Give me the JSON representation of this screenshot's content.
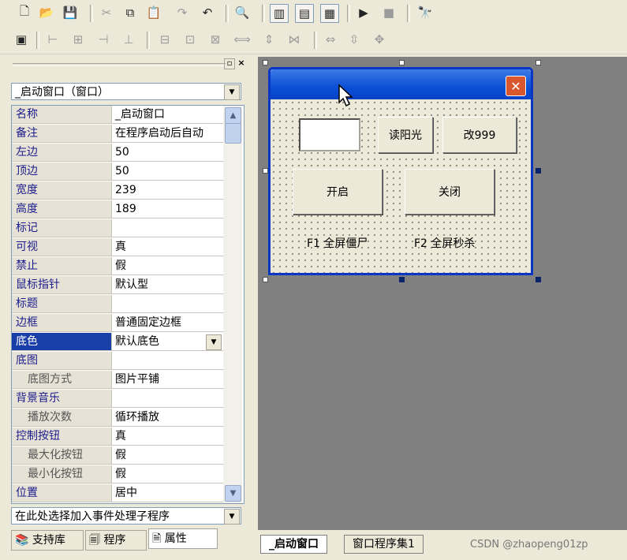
{
  "toolbar1": {
    "icons": [
      "new-file-icon",
      "open-folder-icon",
      "save-icon",
      "cut-icon",
      "copy-icon",
      "paste-icon",
      "redo-icon",
      "undo-icon",
      "find-icon",
      "layout-1-icon",
      "layout-2-icon",
      "layout-3-icon",
      "run-icon",
      "stop-icon",
      "debug-icon"
    ]
  },
  "panel": {
    "selector": "_启动窗口（窗口）",
    "rows": [
      {
        "name": "名称",
        "value": "_启动窗口",
        "sub": false
      },
      {
        "name": "备注",
        "value": "在程序启动后自动",
        "sub": false
      },
      {
        "name": "左边",
        "value": "50",
        "sub": false
      },
      {
        "name": "顶边",
        "value": "50",
        "sub": false
      },
      {
        "name": "宽度",
        "value": "239",
        "sub": false
      },
      {
        "name": "高度",
        "value": "189",
        "sub": false
      },
      {
        "name": "标记",
        "value": "",
        "sub": false
      },
      {
        "name": "可视",
        "value": "真",
        "sub": false
      },
      {
        "name": "禁止",
        "value": "假",
        "sub": false
      },
      {
        "name": "鼠标指针",
        "value": "默认型",
        "sub": false
      },
      {
        "name": "标题",
        "value": "",
        "sub": false
      },
      {
        "name": "边框",
        "value": "普通固定边框",
        "sub": false
      },
      {
        "name": "底色",
        "value": "默认底色",
        "sub": false,
        "selected": true
      },
      {
        "name": "底图",
        "value": "",
        "sub": false
      },
      {
        "name": "底图方式",
        "value": "图片平铺",
        "sub": true
      },
      {
        "name": "背景音乐",
        "value": "",
        "sub": false
      },
      {
        "name": "播放次数",
        "value": "循环播放",
        "sub": true
      },
      {
        "name": "控制按钮",
        "value": "真",
        "sub": false
      },
      {
        "name": "最大化按钮",
        "value": "假",
        "sub": true
      },
      {
        "name": "最小化按钮",
        "value": "假",
        "sub": true
      },
      {
        "name": "位置",
        "value": "居中",
        "sub": false
      }
    ],
    "event_selector": "在此处选择加入事件处理子程序",
    "tabs": [
      "支持库",
      "程序",
      "属性"
    ]
  },
  "form": {
    "btn_read": "读阳光",
    "btn_change": "改999",
    "btn_start": "开启",
    "btn_close": "关闭",
    "label_f1": "F1 全屏僵尸",
    "label_f2": "F2 全屏秒杀"
  },
  "doc_tabs": [
    "_启动窗口",
    "窗口程序集1"
  ],
  "watermark": "CSDN @zhaopeng01zp"
}
